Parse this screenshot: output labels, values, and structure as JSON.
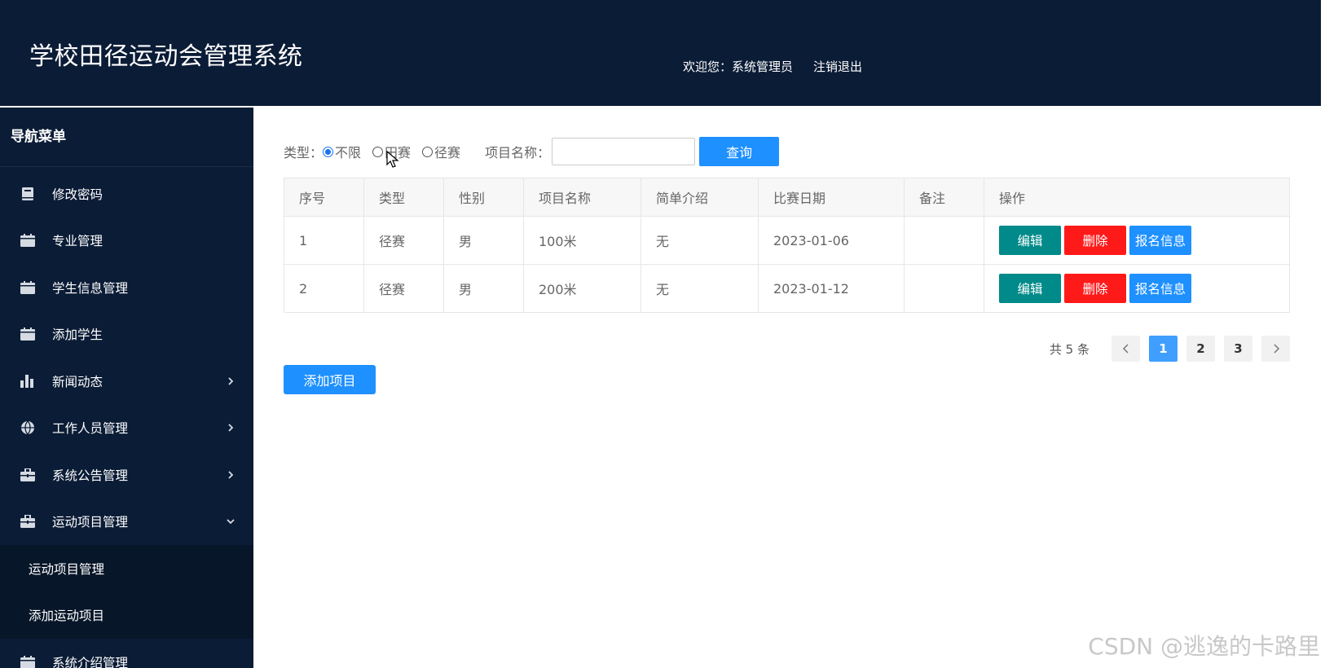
{
  "header": {
    "title": "学校田径运动会管理系统",
    "welcome": "欢迎您：系统管理员",
    "logout": "注销退出"
  },
  "sidebar": {
    "title": "导航菜单",
    "items": [
      {
        "label": "修改密码",
        "icon": "book-icon"
      },
      {
        "label": "专业管理",
        "icon": "calendar-icon"
      },
      {
        "label": "学生信息管理",
        "icon": "calendar-icon"
      },
      {
        "label": "添加学生",
        "icon": "calendar-icon"
      },
      {
        "label": "新闻动态",
        "icon": "bar-chart-icon",
        "expandable": true
      },
      {
        "label": "工作人员管理",
        "icon": "globe-icon",
        "expandable": true
      },
      {
        "label": "系统公告管理",
        "icon": "briefcase-icon",
        "expandable": true
      },
      {
        "label": "运动项目管理",
        "icon": "briefcase-icon",
        "expandable": true,
        "expanded": true
      },
      {
        "label": "系统介绍管理",
        "icon": "calendar-icon"
      }
    ],
    "submenu": [
      "运动项目管理",
      "添加运动项目"
    ]
  },
  "filter": {
    "type_label": "类型：",
    "options": [
      "不限",
      "田赛",
      "径赛"
    ],
    "selected": "不限",
    "name_label": "项目名称：",
    "name_value": "",
    "query_label": "查询"
  },
  "table": {
    "headers": [
      "序号",
      "类型",
      "性别",
      "项目名称",
      "简单介绍",
      "比赛日期",
      "备注",
      "操作"
    ],
    "rows": [
      {
        "no": "1",
        "type": "径赛",
        "gender": "男",
        "name": "100米",
        "intro": "无",
        "date": "2023-01-06",
        "note": ""
      },
      {
        "no": "2",
        "type": "径赛",
        "gender": "男",
        "name": "200米",
        "intro": "无",
        "date": "2023-01-12",
        "note": ""
      }
    ],
    "actions": {
      "edit": "编辑",
      "delete": "删除",
      "signup": "报名信息"
    }
  },
  "pagination": {
    "total_text": "共 5 条",
    "pages": [
      "1",
      "2",
      "3"
    ],
    "current": "1"
  },
  "add_button": "添加项目",
  "watermark": "CSDN @逃逸的卡路里",
  "colors": {
    "header_bg": "#0b1c36",
    "primary": "#1e90ff",
    "edit": "#008a8a",
    "delete": "#ff1a1a"
  }
}
